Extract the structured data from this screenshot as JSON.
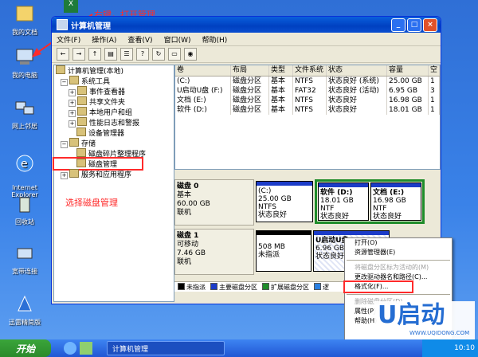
{
  "desktop": {
    "icons": [
      {
        "label": "我的文档"
      },
      {
        "label": "我的电脑"
      },
      {
        "label": "网上邻居"
      },
      {
        "label": "Internet\nExplorer"
      },
      {
        "label": "回收站"
      },
      {
        "label": "宽带连接"
      },
      {
        "label": "迅雷精简版"
      }
    ],
    "annotations": {
      "right_click": "右键，打开管理",
      "select_disk": "选择磁盘管理"
    }
  },
  "window": {
    "title": "计算机管理",
    "menu": [
      "文件(F)",
      "操作(A)",
      "查看(V)",
      "窗口(W)",
      "帮助(H)"
    ],
    "tree": [
      {
        "text": "计算机管理(本地)"
      },
      {
        "text": "系统工具"
      },
      {
        "text": "事件查看器"
      },
      {
        "text": "共享文件夹"
      },
      {
        "text": "本地用户和组"
      },
      {
        "text": "性能日志和警报"
      },
      {
        "text": "设备管理器"
      },
      {
        "text": "存储"
      },
      {
        "text": "磁盘碎片整理程序"
      },
      {
        "text": "磁盘管理"
      },
      {
        "text": "服务和应用程序"
      }
    ],
    "volume_headers": [
      "卷",
      "布局",
      "类型",
      "文件系统",
      "状态",
      "容量",
      "空"
    ],
    "volumes": [
      [
        "(C:)",
        "磁盘分区",
        "基本",
        "NTFS",
        "状态良好 (系统)",
        "25.00 GB",
        "1"
      ],
      [
        "U启动U盘 (F:)",
        "磁盘分区",
        "基本",
        "FAT32",
        "状态良好 (活动)",
        "6.95 GB",
        "3"
      ],
      [
        "文档 (E:)",
        "磁盘分区",
        "基本",
        "NTFS",
        "状态良好",
        "16.98 GB",
        "1"
      ],
      [
        "软件 (D:)",
        "磁盘分区",
        "基本",
        "NTFS",
        "状态良好",
        "18.01 GB",
        "1"
      ]
    ],
    "disk0": {
      "name": "磁盘 0",
      "type": "基本",
      "size": "60.00 GB",
      "status": "联机",
      "parts": [
        {
          "name": "(C:)",
          "size": "25.00 GB NTFS",
          "status": "状态良好"
        },
        {
          "name": "软件 (D:)",
          "size": "18.01 GB NTF",
          "status": "状态良好"
        },
        {
          "name": "文档 (E:)",
          "size": "16.98 GB NTF",
          "status": "状态良好"
        }
      ]
    },
    "disk1": {
      "name": "磁盘 1",
      "type": "可移动",
      "size": "7.46 GB",
      "status": "联机",
      "parts": [
        {
          "name": "508 MB",
          "status": "未指派"
        },
        {
          "name": "U启动U盘",
          "size": "6.96 GB",
          "status": "状态良好"
        }
      ]
    },
    "legend": [
      "未指派",
      "主要磁盘分区",
      "扩展磁盘分区",
      "逻"
    ]
  },
  "context_menu": {
    "items": [
      {
        "label": "打开(O)",
        "disabled": false
      },
      {
        "label": "资源管理器(E)",
        "disabled": false
      },
      {
        "sep": true
      },
      {
        "label": "将磁盘分区标为活动的(M)",
        "disabled": true
      },
      {
        "label": "更改驱动器名和路径(C)...",
        "disabled": false
      },
      {
        "label": "格式化(F)...",
        "disabled": false
      },
      {
        "sep": true
      },
      {
        "label": "删除磁盘分区(D)...",
        "disabled": true
      },
      {
        "label": "属性(P)",
        "disabled": false
      },
      {
        "label": "帮助(H)",
        "disabled": false
      }
    ]
  },
  "taskbar": {
    "start": "开始",
    "task": "计算机管理",
    "clock": "10:10"
  },
  "brand": {
    "logo": "U启动",
    "url": "WWW.UQIDONG.COM"
  },
  "colors": {
    "annotation": "#ff2a2a",
    "primary_partition": "#1c3cc8",
    "extended_partition": "#1f8c2a",
    "unallocated": "#000000"
  }
}
